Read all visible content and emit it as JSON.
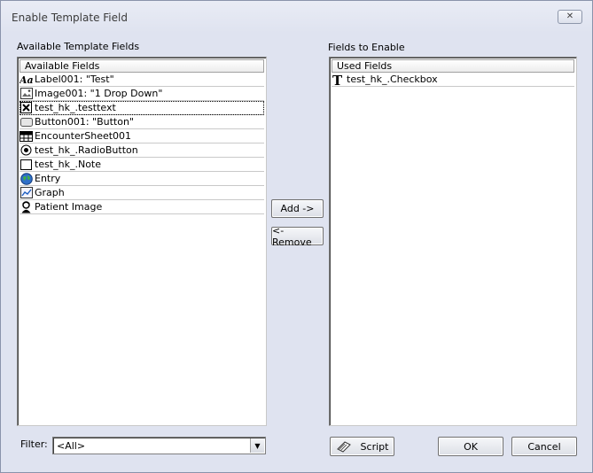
{
  "window": {
    "title": "Enable Template Field",
    "close_glyph": "✕"
  },
  "available": {
    "group_label": "Available Template Fields",
    "header": "Available Fields",
    "items": [
      {
        "label": "Label001: \"Test\"",
        "icon": "label-icon"
      },
      {
        "label": "Image001: \"1 Drop Down\"",
        "icon": "image-icon"
      },
      {
        "label": "test_hk_.testtext",
        "icon": "textbox-icon"
      },
      {
        "label": "Button001: \"Button\"",
        "icon": "button-icon"
      },
      {
        "label": "EncounterSheet001",
        "icon": "grid-icon"
      },
      {
        "label": "test_hk_.RadioButton",
        "icon": "radio-icon"
      },
      {
        "label": "test_hk_.Note",
        "icon": "note-icon"
      },
      {
        "label": "Entry",
        "icon": "globe-icon"
      },
      {
        "label": "Graph",
        "icon": "graph-icon"
      },
      {
        "label": "Patient Image",
        "icon": "patient-icon"
      }
    ]
  },
  "enabled": {
    "group_label": "Fields to Enable",
    "header": "Used Fields",
    "items": [
      {
        "label": "test_hk_.Checkbox",
        "icon": "text-t-icon"
      }
    ]
  },
  "buttons": {
    "add": "Add ->",
    "remove": "<- Remove",
    "script": "Script",
    "ok": "OK",
    "cancel": "Cancel"
  },
  "filter": {
    "label": "Filter:",
    "value": "<All>"
  }
}
